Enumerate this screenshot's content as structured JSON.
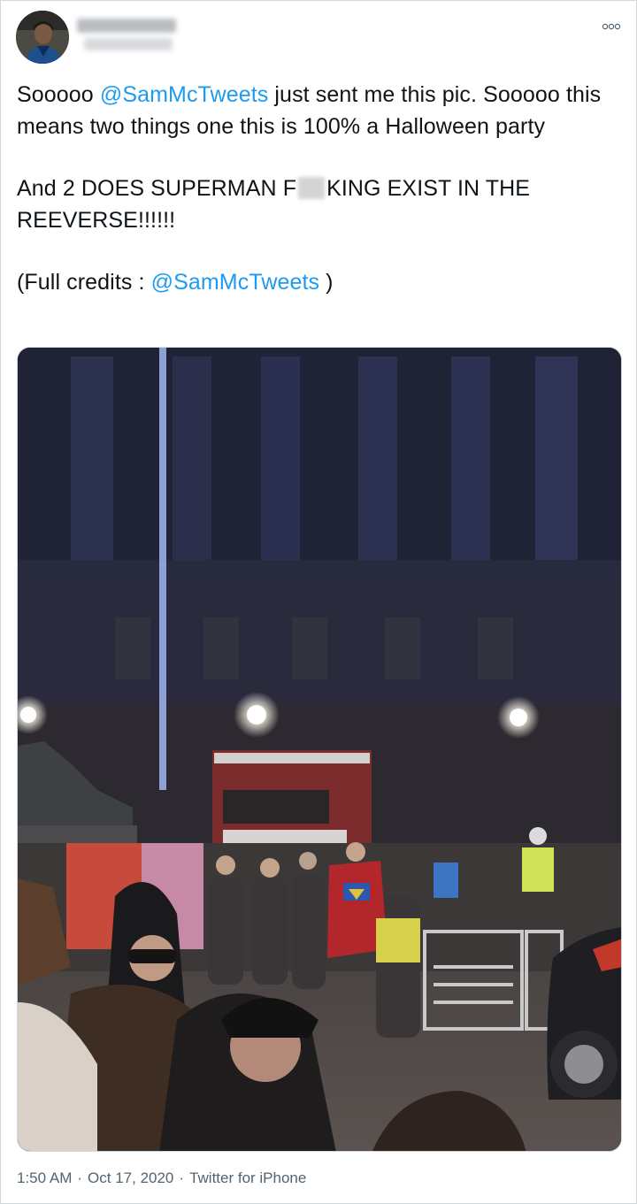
{
  "author": {
    "avatar_icon": "profile-avatar",
    "display_name_blurred": true
  },
  "more_icon": "more-options-icon",
  "tweet": {
    "line1_pre": "Sooooo ",
    "line1_mention": "@SamMcTweets",
    "line1_post": " just sent me this pic. Sooooo this means two things one this is 100% a Halloween party",
    "line2_pre": "And 2 DOES SUPERMAN F",
    "line2_post": "KING EXIST IN THE REEVERSE!!!!!!",
    "line3_pre": "(Full credits : ",
    "line3_mention": "@SamMcTweets",
    "line3_post": " )"
  },
  "photo_icon": "night-film-set-photo",
  "meta": {
    "time": "1:50 AM",
    "date": "Oct 17, 2020",
    "source": "Twitter for iPhone"
  },
  "colors": {
    "link": "#1d9bf0",
    "text": "#0f1419",
    "secondary": "#536471",
    "border": "#cfd9de"
  }
}
